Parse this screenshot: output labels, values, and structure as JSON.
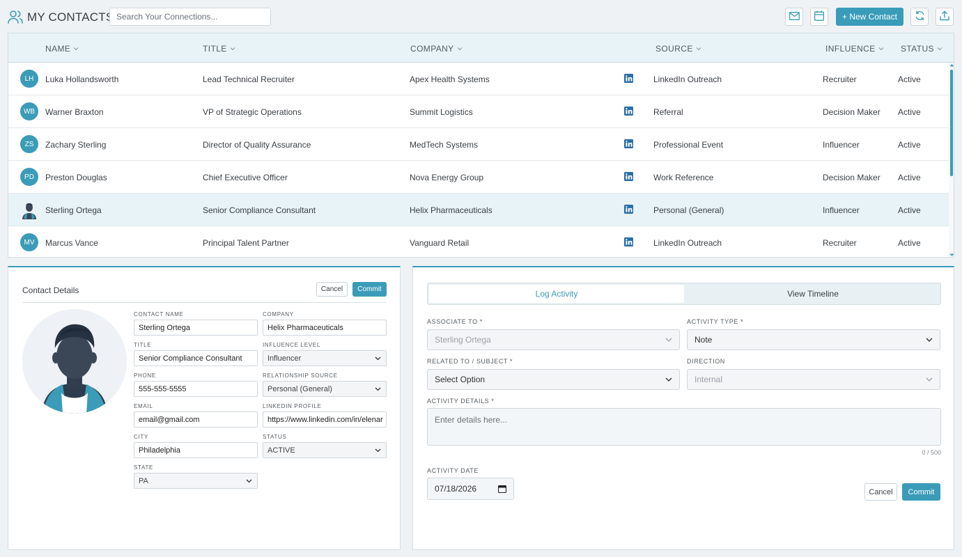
{
  "app": {
    "title": "MY CONTACTS",
    "search_placeholder": "Search Your Connections...",
    "new_contact_label": "+ New Contact"
  },
  "toolbar_icons": [
    "mail-icon",
    "calendar-icon",
    "refresh-icon",
    "upload-icon"
  ],
  "table": {
    "columns": {
      "name": "NAME",
      "title": "TITLE",
      "company": "COMPANY",
      "source": "SOURCE",
      "influence": "INFLUENCE",
      "status": "STATUS"
    },
    "rows": [
      {
        "initials": "LH",
        "name": "Luka Hollandsworth",
        "title": "Lead Technical Recruiter",
        "company": "Apex Health Systems",
        "source": "LinkedIn Outreach",
        "influence": "Recruiter",
        "status": "Active"
      },
      {
        "initials": "WB",
        "name": "Warner Braxton",
        "title": "VP of Strategic Operations",
        "company": "Summit Logistics",
        "source": "Referral",
        "influence": "Decision Maker",
        "status": "Active"
      },
      {
        "initials": "ZS",
        "name": "Zachary Sterling",
        "title": "Director of Quality Assurance",
        "company": "MedTech Systems",
        "source": "Professional Event",
        "influence": "Influencer",
        "status": "Active"
      },
      {
        "initials": "PD",
        "name": "Preston Douglas",
        "title": "Chief Executive Officer",
        "company": "Nova Energy Group",
        "source": "Work Reference",
        "influence": "Decision Maker",
        "status": "Active"
      },
      {
        "initials": "",
        "name": "Sterling Ortega",
        "title": "Senior Compliance Consultant",
        "company": "Helix Pharmaceuticals",
        "source": "Personal (General)",
        "influence": "Influencer",
        "status": "Active"
      },
      {
        "initials": "MV",
        "name": "Marcus Vance",
        "title": "Principal Talent Partner",
        "company": "Vanguard Retail",
        "source": "LinkedIn Outreach",
        "influence": "Recruiter",
        "status": "Active"
      }
    ]
  },
  "contact_details": {
    "title": "Contact Details",
    "cancel_label": "Cancel",
    "commit_label": "Commit",
    "labels": {
      "contact_name": "CONTACT NAME",
      "company": "COMPANY",
      "title": "TITLE",
      "influence_level": "INFLUENCE LEVEL",
      "phone": "PHONE",
      "relationship_source": "RELATIONSHIP SOURCE",
      "email": "EMAIL",
      "linkedin_profile": "LINKEDIN PROFILE",
      "city": "CITY",
      "status": "STATUS",
      "state": "STATE"
    },
    "values": {
      "contact_name": "Sterling Ortega",
      "company": "Helix Pharmaceuticals",
      "title": "Senior Compliance Consultant",
      "influence_level": "Influencer",
      "phone": "555-555-5555",
      "relationship_source": "Personal (General)",
      "email": "email@gmail.com",
      "linkedin_profile": "https://www.linkedin.com/in/elenar",
      "city": "Philadelphia",
      "status": "ACTIVE",
      "state": "PA"
    }
  },
  "activity": {
    "tab_log": "Log Activity",
    "tab_timeline": "View Timeline",
    "labels": {
      "associate_to": "ASSOCIATE TO *",
      "activity_type": "ACTIVITY TYPE *",
      "related_to": "RELATED TO / SUBJECT *",
      "direction": "DIRECTION",
      "details": "ACTIVITY DETAILS *",
      "date": "ACTIVITY DATE"
    },
    "values": {
      "associate_to": "Sterling Ortega",
      "activity_type": "Note",
      "related_to": "Select Option",
      "direction": "Internal",
      "date": "07/18/2026"
    },
    "details_placeholder": "Enter details here...",
    "counter": "0 / 500",
    "cancel_label": "Cancel",
    "commit_label": "Commit"
  },
  "colors": {
    "accent": "#3a9cb8",
    "header_bg": "#e7f3f7",
    "selected_row_bg": "#e7f3f6"
  }
}
